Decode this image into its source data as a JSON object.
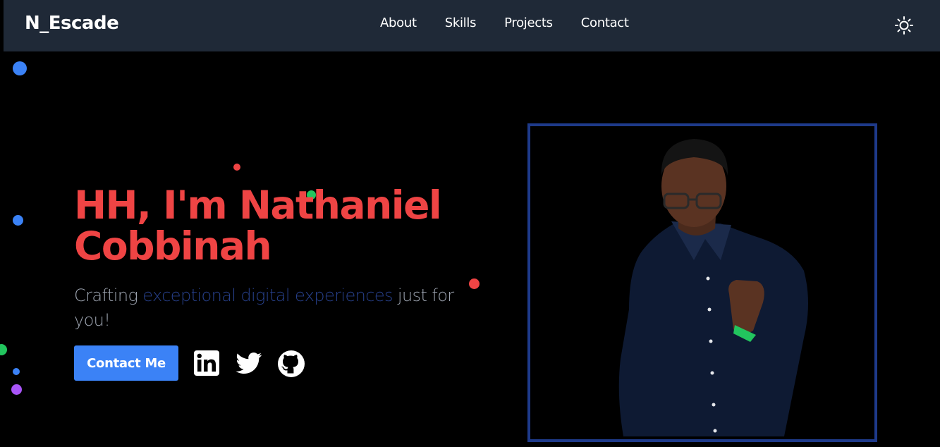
{
  "nav": {
    "brand": "N_Escade",
    "links": [
      "About",
      "Skills",
      "Projects",
      "Contact"
    ],
    "theme_icon": "sun-icon"
  },
  "hero": {
    "title": "HH, I'm Nathaniel Cobbinah",
    "subtitle_before": "Crafting ",
    "subtitle_accent": "exceptional digital experiences",
    "subtitle_after": " just for you!",
    "contact_button": "Contact Me",
    "socials": [
      "linkedin-icon",
      "twitter-icon",
      "github-icon"
    ]
  },
  "colors": {
    "nav_bg": "#1f2937",
    "title": "#ef4444",
    "accent": "#27408b",
    "button": "#3b82f6",
    "frame_border": "#1e3a8a"
  }
}
